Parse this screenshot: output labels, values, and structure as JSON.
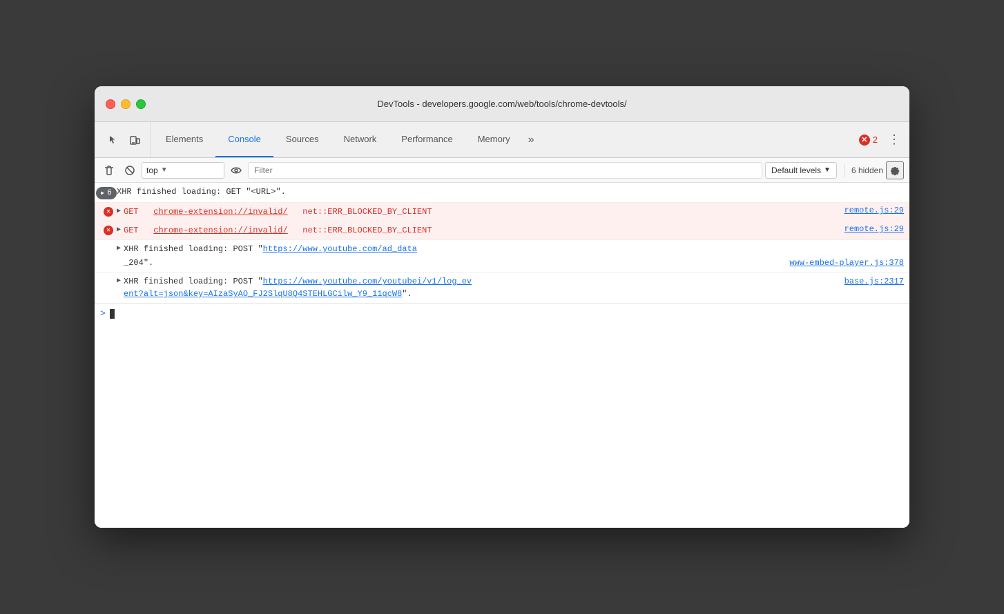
{
  "window": {
    "title": "DevTools - developers.google.com/web/tools/chrome-devtools/"
  },
  "tabs": [
    {
      "id": "elements",
      "label": "Elements",
      "active": false
    },
    {
      "id": "console",
      "label": "Console",
      "active": true
    },
    {
      "id": "sources",
      "label": "Sources",
      "active": false
    },
    {
      "id": "network",
      "label": "Network",
      "active": false
    },
    {
      "id": "performance",
      "label": "Performance",
      "active": false
    },
    {
      "id": "memory",
      "label": "Memory",
      "active": false
    }
  ],
  "error_badge": {
    "count": "2"
  },
  "console_toolbar": {
    "context_label": "top",
    "filter_placeholder": "Filter",
    "levels_label": "Default levels",
    "hidden_count": "6 hidden"
  },
  "log_entries": [
    {
      "id": "log1",
      "type": "xhr",
      "badge_count": "6",
      "text": "XHR finished loading: GET \"<URL>\".",
      "source": null
    },
    {
      "id": "log2",
      "type": "error",
      "method": "GET",
      "url": "chrome-extension://invalid/",
      "error": "net::ERR_BLOCKED_BY_CLIENT",
      "source": "remote.js:29"
    },
    {
      "id": "log3",
      "type": "error",
      "method": "GET",
      "url": "chrome-extension://invalid/",
      "error": "net::ERR_BLOCKED_BY_CLIENT",
      "source": "remote.js:29"
    },
    {
      "id": "log4",
      "type": "xhr-post",
      "text1": "XHR finished loading: POST \"",
      "url": "https://www.youtube.com/ad_data",
      "text2": "",
      "source": "www-embed-player.js:378",
      "source2": "_204",
      "suffix": "\"."
    },
    {
      "id": "log5",
      "type": "xhr-post2",
      "text1": "XHR finished loading: POST \"",
      "url": "https://www.youtube.com/youtubei/v1/log_ev",
      "url2": "ent?alt=json&key=AIzaSyAO_FJ2SlqU8Q4STEHLGCilw_Y9_11qcW8",
      "suffix": "\".",
      "source": "base.js:2317"
    }
  ],
  "colors": {
    "active_tab": "#1a73e8",
    "error_red": "#d93025",
    "error_bg": "#fff0f0"
  }
}
